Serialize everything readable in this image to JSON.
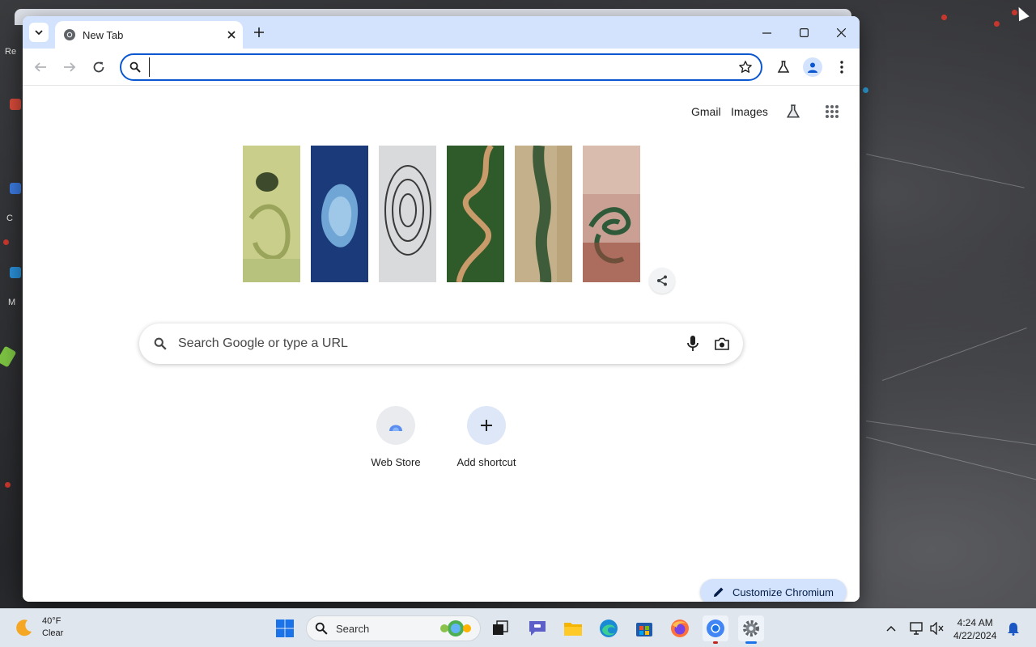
{
  "browser": {
    "tab": {
      "title": "New Tab"
    },
    "omnibox": {
      "value": "",
      "placeholder": ""
    }
  },
  "ntp": {
    "top_links": [
      "Gmail",
      "Images"
    ],
    "search": {
      "placeholder": "Search Google or type a URL"
    },
    "shortcuts": [
      {
        "label": "Web Store",
        "icon": "web-store-icon"
      },
      {
        "label": "Add shortcut",
        "icon": "plus-icon"
      }
    ],
    "customize_label": "Customize Chromium"
  },
  "desktop": {
    "icon_labels": [
      "Re",
      "C",
      "M"
    ]
  },
  "taskbar": {
    "weather": {
      "temp": "40°F",
      "condition": "Clear"
    },
    "search_label": "Search",
    "clock": {
      "time": "4:24 AM",
      "date": "4/22/2024"
    }
  },
  "colors": {
    "titlebar": "#d3e3fd",
    "accent": "#0b57d0",
    "customize_bg": "#d3e3fd",
    "taskbar": "#dfe6ee"
  }
}
